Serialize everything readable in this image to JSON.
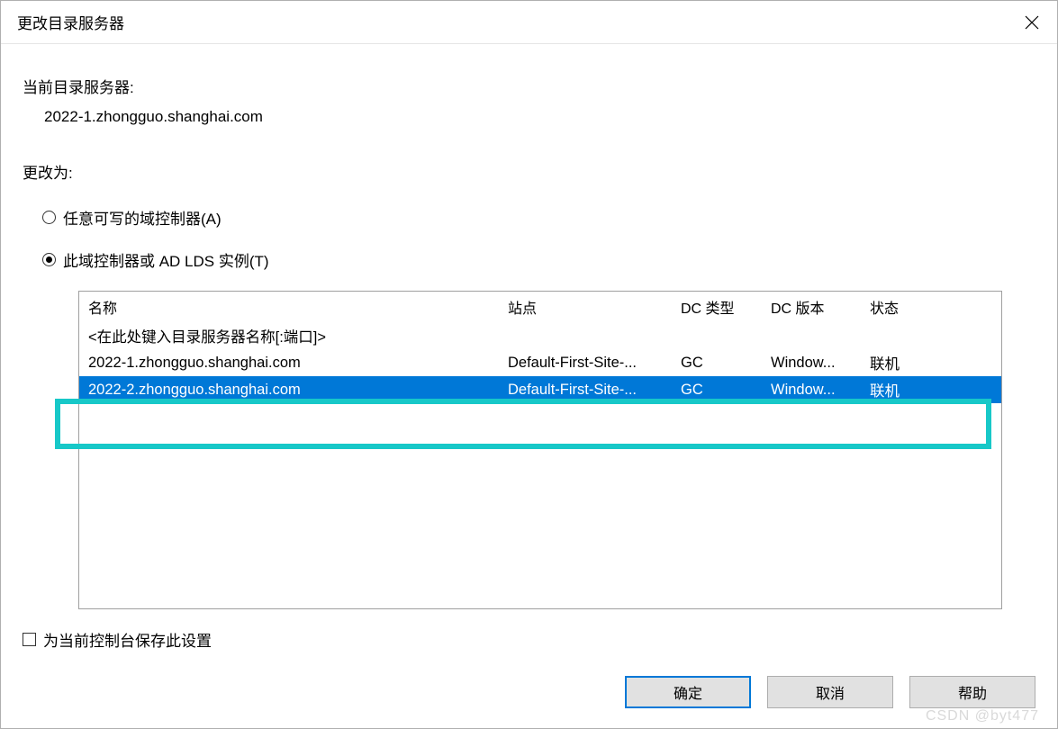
{
  "dialog": {
    "title": "更改目录服务器",
    "current_label": "当前目录服务器:",
    "current_value": "2022-1.zhongguo.shanghai.com",
    "change_to_label": "更改为:",
    "radio_any_writable": "任意可写的域控制器(A)",
    "radio_this_dc": "此域控制器或 AD LDS 实例(T)",
    "radio_selected": "this_dc",
    "save_checkbox_label": "为当前控制台保存此设置",
    "save_checkbox_checked": false
  },
  "table": {
    "columns": {
      "name": "名称",
      "site": "站点",
      "dctype": "DC 类型",
      "dcver": "DC 版本",
      "status": "状态"
    },
    "placeholder_row": "<在此处键入目录服务器名称[:端口]>",
    "rows": [
      {
        "name": "2022-1.zhongguo.shanghai.com",
        "site": "Default-First-Site-...",
        "dctype": "GC",
        "dcver": "Window...",
        "status": "联机",
        "selected": false
      },
      {
        "name": "2022-2.zhongguo.shanghai.com",
        "site": "Default-First-Site-...",
        "dctype": "GC",
        "dcver": "Window...",
        "status": "联机",
        "selected": true
      }
    ]
  },
  "buttons": {
    "ok": "确定",
    "cancel": "取消",
    "help": "帮助"
  },
  "watermark": "CSDN @byt477"
}
